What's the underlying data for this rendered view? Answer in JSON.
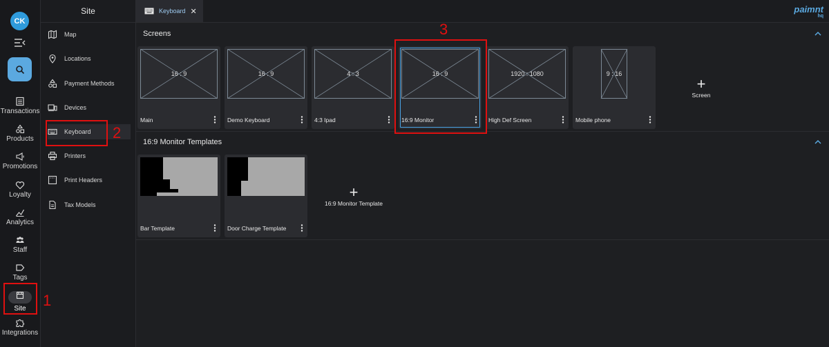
{
  "user": {
    "initials": "CK"
  },
  "rail": {
    "items": [
      {
        "label": "Transactions"
      },
      {
        "label": "Products"
      },
      {
        "label": "Promotions"
      },
      {
        "label": "Loyalty"
      },
      {
        "label": "Analytics"
      },
      {
        "label": "Staff"
      },
      {
        "label": "Tags"
      },
      {
        "label": "Site"
      },
      {
        "label": "Integrations"
      }
    ]
  },
  "nav": {
    "title": "Site",
    "items": [
      {
        "label": "Map"
      },
      {
        "label": "Locations"
      },
      {
        "label": "Payment Methods"
      },
      {
        "label": "Devices"
      },
      {
        "label": "Keyboard"
      },
      {
        "label": "Printers"
      },
      {
        "label": "Print Headers"
      },
      {
        "label": "Tax Models"
      }
    ]
  },
  "tab": {
    "label": "Keyboard",
    "close": "✕"
  },
  "brand": {
    "name": "paimnt",
    "sub": "hq"
  },
  "screens": {
    "title": "Screens",
    "cards": [
      {
        "label": "Main",
        "ratio": "16 : 9"
      },
      {
        "label": "Demo Keyboard",
        "ratio": "16 : 9"
      },
      {
        "label": "4:3 Ipad",
        "ratio": "4 : 3"
      },
      {
        "label": "16:9 Monitor",
        "ratio": "16 : 9"
      },
      {
        "label": "High Def Screen",
        "ratio": "1920 : 1080"
      },
      {
        "label": "Mobile phone",
        "ratio": "9 : 16"
      }
    ],
    "add_label": "Screen"
  },
  "templates": {
    "title": "16:9 Monitor Templates",
    "cards": [
      {
        "label": "Bar Template"
      },
      {
        "label": "Door Charge Template"
      }
    ],
    "add_label": "16:9 Monitor Template"
  },
  "annotations": [
    "1",
    "2",
    "3"
  ],
  "colors": {
    "accent": "#5ba9e0",
    "highlight": "#e01010",
    "background": "#1e1f22"
  }
}
